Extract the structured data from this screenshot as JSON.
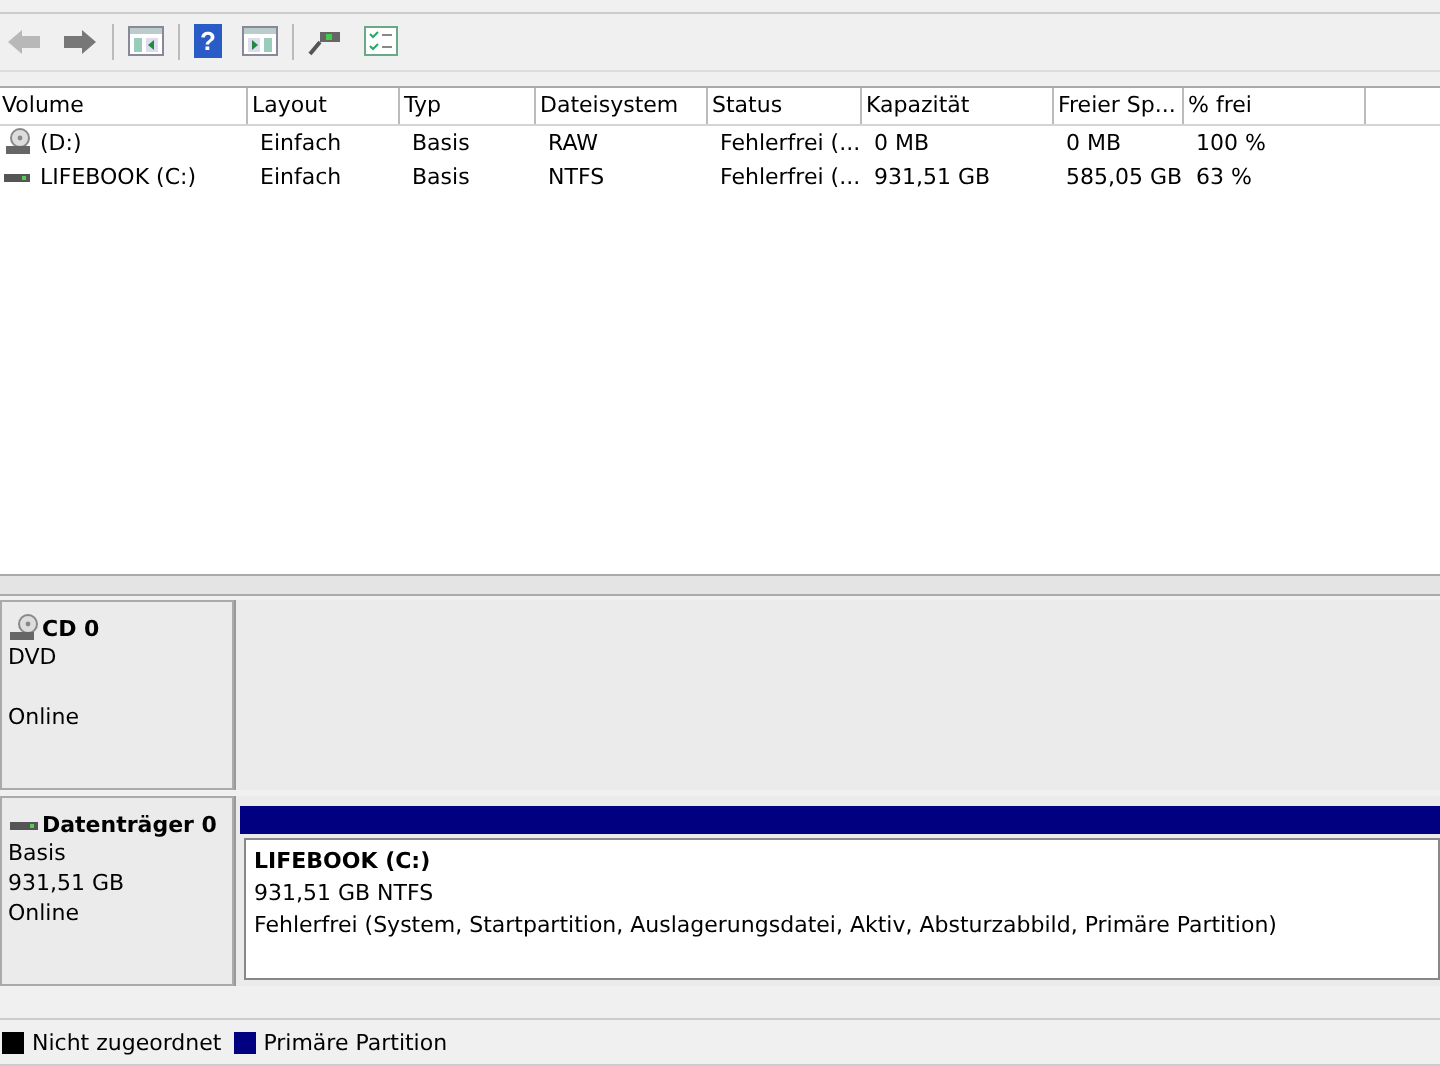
{
  "toolbar": {
    "buttons": [
      {
        "kind": "back",
        "disabled": true
      },
      {
        "kind": "forward",
        "disabled": false
      },
      {
        "kind": "panel"
      },
      {
        "kind": "help",
        "label": "?"
      },
      {
        "kind": "panel2"
      },
      {
        "kind": "connect"
      },
      {
        "kind": "check"
      }
    ]
  },
  "table": {
    "columns": [
      "Volume",
      "Layout",
      "Typ",
      "Dateisystem",
      "Status",
      "Kapazität",
      "Freier Sp...",
      "% frei"
    ],
    "rows": [
      {
        "kind": "cd",
        "cells": [
          "(D:)",
          "Einfach",
          "Basis",
          "RAW",
          "Fehlerfrei (...",
          "0 MB",
          "0 MB",
          "100 %"
        ]
      },
      {
        "kind": "disk",
        "cells": [
          "LIFEBOOK (C:)",
          "Einfach",
          "Basis",
          "NTFS",
          "Fehlerfrei (...",
          "931,51 GB",
          "585,05 GB",
          "63 %"
        ]
      }
    ]
  },
  "disks": [
    {
      "kind": "cd",
      "name": "CD 0",
      "lines": [
        "DVD"
      ],
      "status": "Online"
    },
    {
      "kind": "disk",
      "name": "Datenträger 0",
      "lines": [
        "Basis",
        "931,51 GB"
      ],
      "status": "Online",
      "partitions": [
        {
          "color": "#000080",
          "name": "LIFEBOOK  (C:)",
          "size": "931,51 GB NTFS",
          "status": "Fehlerfrei (System, Startpartition, Auslagerungsdatei, Aktiv, Absturzabbild, Primäre Partition)"
        }
      ]
    }
  ],
  "legend": [
    {
      "label": "Nicht zugeordnet",
      "color": "#000000"
    },
    {
      "label": "Primäre Partition",
      "color": "#000080"
    }
  ]
}
